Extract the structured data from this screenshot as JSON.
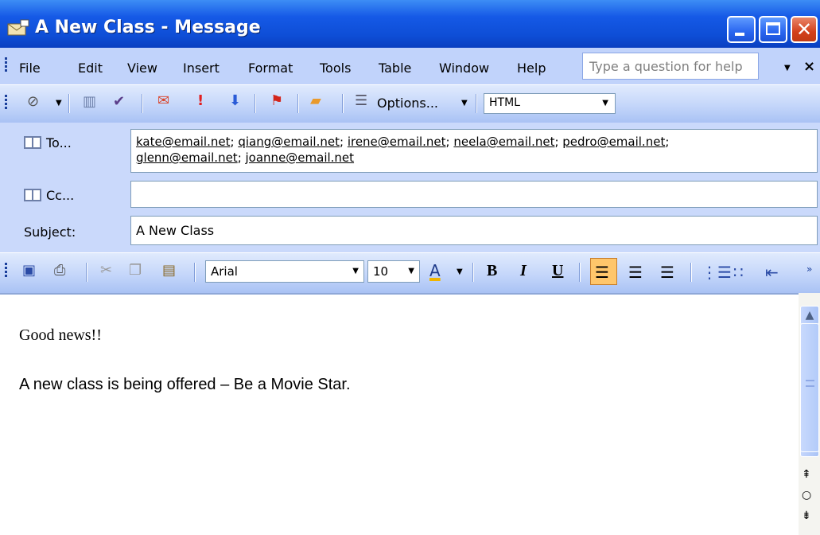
{
  "window": {
    "title": "A New Class - Message",
    "min_icon": "minimize-icon",
    "max_icon": "maximize-icon",
    "close_glyph": "✕"
  },
  "menu": {
    "items": [
      "File",
      "Edit",
      "View",
      "Insert",
      "Format",
      "Tools",
      "Table",
      "Window",
      "Help"
    ],
    "help_placeholder": "Type a question for help",
    "close_glyph": "×"
  },
  "toolbar": {
    "options_label": "Options...",
    "format_value": "HTML"
  },
  "header": {
    "to_label": "To...",
    "to": [
      "kate@email.net",
      "qiang@email.net",
      "irene@email.net",
      "neela@email.net",
      "pedro@email.net",
      "glenn@email.net",
      "joanne@email.net"
    ],
    "cc_label": "Cc...",
    "cc": "",
    "subject_label": "Subject:",
    "subject": "A New Class"
  },
  "format_toolbar": {
    "font": "Arial",
    "size": "10",
    "bold": "B",
    "italic": "I",
    "underline": "U",
    "font_color": "A"
  },
  "body": {
    "greeting": "Good news!!",
    "line": "A new class is being offered – Be a Movie Star."
  },
  "colors": {
    "title_bar": "#0e4ed6",
    "toolbar": "#c4d6fa",
    "align_active": "#ffc66b",
    "header_bg": "#cad9fb"
  }
}
